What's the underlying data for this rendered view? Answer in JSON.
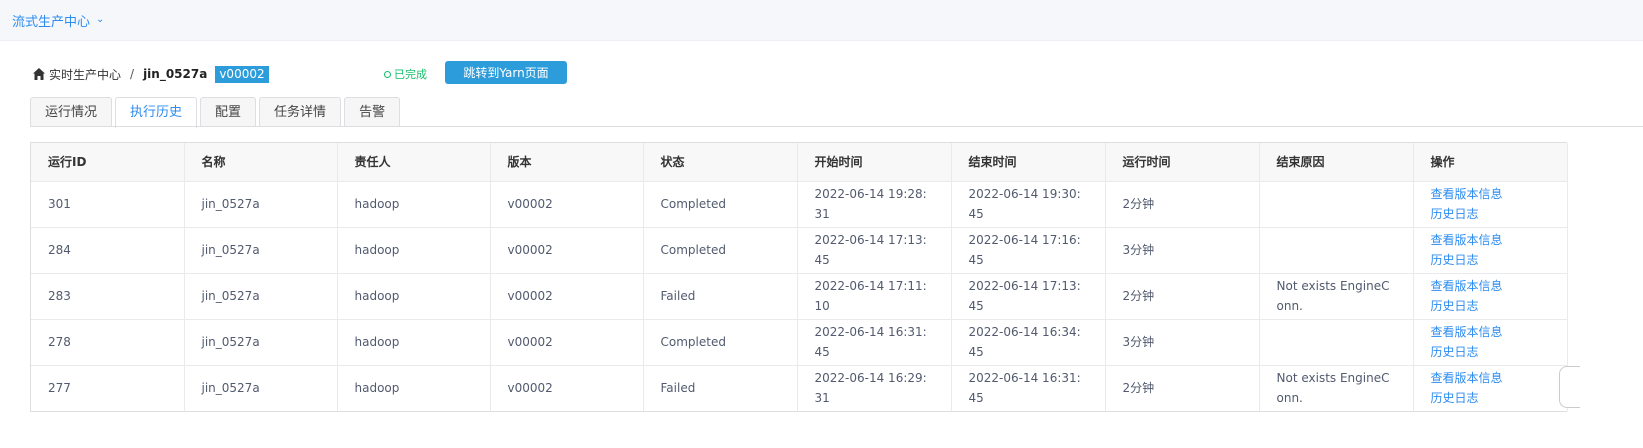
{
  "topbar": {
    "app_menu_label": "流式生产中心"
  },
  "breadcrumb": {
    "home_label": "实时生产中心",
    "separator": "/",
    "job_name": "jin_0527a",
    "version": "v00002"
  },
  "job_status": {
    "label": "已完成",
    "color": "#19be6b"
  },
  "actions": {
    "yarn_button_label": "跳转到Yarn页面"
  },
  "tabs": [
    {
      "label": "运行情况",
      "active": false
    },
    {
      "label": "执行历史",
      "active": true
    },
    {
      "label": "配置",
      "active": false
    },
    {
      "label": "任务详情",
      "active": false
    },
    {
      "label": "告警",
      "active": false
    }
  ],
  "table": {
    "columns": [
      "运行ID",
      "名称",
      "责任人",
      "版本",
      "状态",
      "开始时间",
      "结束时间",
      "运行时间",
      "结束原因",
      "操作"
    ],
    "rows": [
      {
        "id": "301",
        "name": "jin_0527a",
        "owner": "hadoop",
        "version": "v00002",
        "status": "Completed",
        "start": "2022-06-14 19:28:31",
        "end": "2022-06-14 19:30:45",
        "duration": "2分钟",
        "reason": "",
        "op1": "查看版本信息",
        "op2": "历史日志"
      },
      {
        "id": "284",
        "name": "jin_0527a",
        "owner": "hadoop",
        "version": "v00002",
        "status": "Completed",
        "start": "2022-06-14 17:13:45",
        "end": "2022-06-14 17:16:45",
        "duration": "3分钟",
        "reason": "",
        "op1": "查看版本信息",
        "op2": "历史日志"
      },
      {
        "id": "283",
        "name": "jin_0527a",
        "owner": "hadoop",
        "version": "v00002",
        "status": "Failed",
        "start": "2022-06-14 17:11:10",
        "end": "2022-06-14 17:13:45",
        "duration": "2分钟",
        "reason": "Not exists EngineConn.",
        "op1": "查看版本信息",
        "op2": "历史日志"
      },
      {
        "id": "278",
        "name": "jin_0527a",
        "owner": "hadoop",
        "version": "v00002",
        "status": "Completed",
        "start": "2022-06-14 16:31:45",
        "end": "2022-06-14 16:34:45",
        "duration": "3分钟",
        "reason": "",
        "op1": "查看版本信息",
        "op2": "历史日志"
      },
      {
        "id": "277",
        "name": "jin_0527a",
        "owner": "hadoop",
        "version": "v00002",
        "status": "Failed",
        "start": "2022-06-14 16:29:31",
        "end": "2022-06-14 16:31:45",
        "duration": "2分钟",
        "reason": "Not exists EngineConn.",
        "op1": "查看版本信息",
        "op2": "历史日志"
      }
    ]
  },
  "icons": {
    "home": "home-icon",
    "chevron": "chevron-down-icon",
    "status": "circle-icon"
  },
  "colors": {
    "accent": "#2d8cf0",
    "tag": "#2d9cdb",
    "success": "#19be6b"
  }
}
